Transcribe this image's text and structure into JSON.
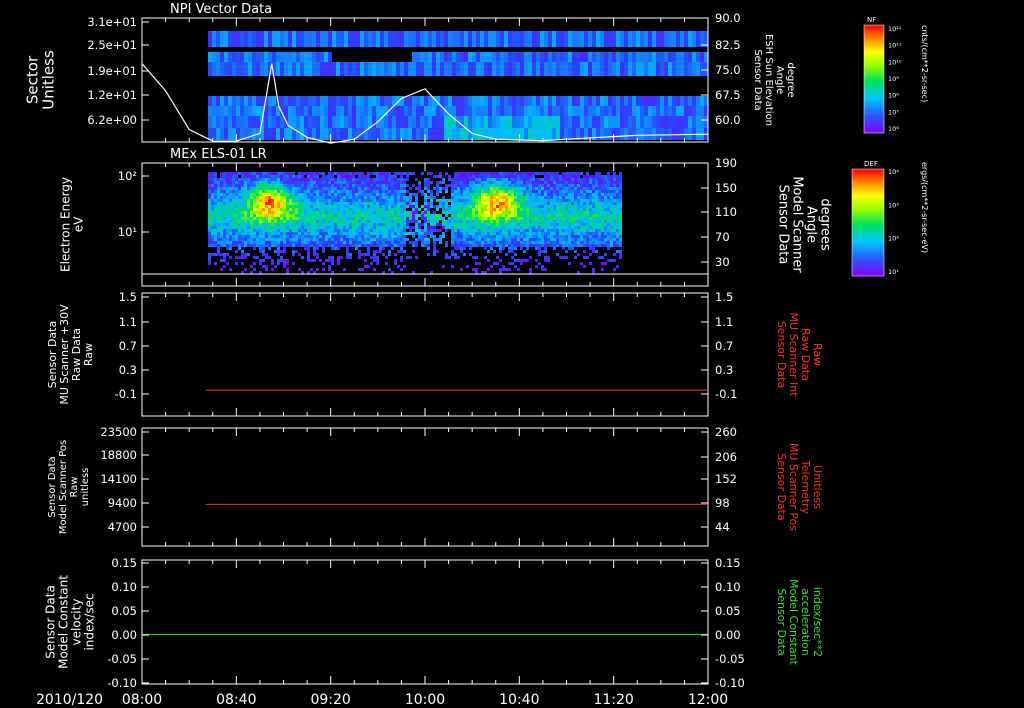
{
  "chart_data": [
    {
      "type": "heatmap",
      "title": "NPI Vector Data",
      "ylabel": [
        "Sector",
        "Unitless"
      ],
      "yticks": [
        "3.1e+01",
        "2.5e+01",
        "1.9e+01",
        "1.2e+01",
        "6.2e+00"
      ],
      "ylabel_right": [
        "Sensor Data",
        "ESH Sun Elevation",
        "Angle",
        "degree"
      ],
      "yticks_right": [
        "90.0",
        "82.5",
        "75.0",
        "67.5",
        "60.0"
      ],
      "colorbar": {
        "label": "NF",
        "unit": "cnts/(cm**2-sr-sec)",
        "ticks": [
          "10¹²",
          "10¹¹",
          "10¹⁰",
          "10⁹",
          "10⁸",
          "10⁷",
          "10⁶"
        ]
      },
      "overlay_line": {
        "color": "#ffffff",
        "points": [
          [
            0,
            79
          ],
          [
            10,
            72
          ],
          [
            20,
            62
          ],
          [
            30,
            59
          ],
          [
            40,
            59
          ],
          [
            50,
            61
          ],
          [
            52,
            68
          ],
          [
            55,
            79
          ],
          [
            58,
            68
          ],
          [
            62,
            63
          ],
          [
            70,
            60
          ],
          [
            80,
            58.5
          ],
          [
            90,
            59.5
          ],
          [
            100,
            64
          ],
          [
            110,
            70
          ],
          [
            120,
            72.5
          ],
          [
            130,
            66
          ],
          [
            140,
            61
          ],
          [
            150,
            59.5
          ],
          [
            160,
            59.3
          ],
          [
            170,
            59.1
          ],
          [
            180,
            59.5
          ],
          [
            210,
            60.5
          ],
          [
            240,
            60.8
          ]
        ]
      }
    },
    {
      "type": "heatmap",
      "title": "MEx ELS-01 LR",
      "ylabel": [
        "Electron Energy",
        "eV"
      ],
      "yticks": [
        "10²",
        "10¹"
      ],
      "ylabel_right": [
        "Sensor Data",
        "Model Scanner",
        "Angle",
        "degrees"
      ],
      "yticks_right": [
        "190",
        "150",
        "110",
        "70",
        "30"
      ],
      "colorbar": {
        "label": "DEF",
        "unit": "ergs/(cm**2-sr-sec-eV)",
        "ticks": [
          "10⁴",
          "10³",
          "10²",
          "10¹"
        ]
      },
      "overlay_line": {
        "color": "#ffffff",
        "value": 11
      }
    },
    {
      "type": "line",
      "ylabel": [
        "Sensor Data",
        "MU Scanner +30V",
        "Raw Data",
        "Raw"
      ],
      "yticks": [
        "1.5",
        "1.1",
        "0.7",
        "0.3",
        "-0.1"
      ],
      "ylabel_right": [
        "Sensor Data",
        "MU Scanner Int",
        "Raw Data",
        "Raw"
      ],
      "yticks_right": [
        "1.5",
        "1.1",
        "0.7",
        "0.3",
        "-0.1"
      ],
      "ylim": [
        -0.4,
        1.5
      ],
      "series": [
        {
          "color": "#ff2a2a",
          "x_start_min": 27,
          "x_end_min": 240,
          "value": 0
        }
      ]
    },
    {
      "type": "line",
      "ylabel": [
        "Sensor Data",
        "Model Scanner Pos",
        "Raw",
        "unitless"
      ],
      "yticks": [
        "23500",
        "18800",
        "14100",
        "9400",
        "4700"
      ],
      "ylabel_right": [
        "Sensor Data",
        "MU Scanner Pos",
        "Telemetry",
        "Unitless"
      ],
      "yticks_right": [
        "260",
        "206",
        "152",
        "98",
        "44"
      ],
      "ylim": [
        0,
        23500
      ],
      "series": [
        {
          "color": "#ff2a2a",
          "x_start_min": 27,
          "x_end_min": 240,
          "value": 8300
        }
      ]
    },
    {
      "type": "line",
      "ylabel": [
        "Sensor Data",
        "Model Constant",
        "velocity",
        "index/sec"
      ],
      "yticks": [
        "0.15",
        "0.10",
        "0.05",
        "0.00",
        "-0.05",
        "-0.10"
      ],
      "ylabel_right": [
        "Sensor Data",
        "Model Constant",
        "acceleration",
        "index/sec**2"
      ],
      "yticks_right": [
        "0.15",
        "0.10",
        "0.05",
        "0.00",
        "-0.05",
        "-0.10"
      ],
      "ylim": [
        -0.1,
        0.15
      ],
      "series": [
        {
          "color": "#33dd33",
          "x_start_min": 0,
          "x_end_min": 240,
          "value": 0
        }
      ]
    }
  ],
  "x_axis": {
    "date_label": "2010/120",
    "ticks": [
      "08:00",
      "08:40",
      "09:20",
      "10:00",
      "10:40",
      "11:20",
      "12:00"
    ]
  },
  "colors": {
    "background": "#000000",
    "axis": "#ffffff",
    "red_label": "#ff2a2a",
    "green_label": "#33dd33"
  }
}
